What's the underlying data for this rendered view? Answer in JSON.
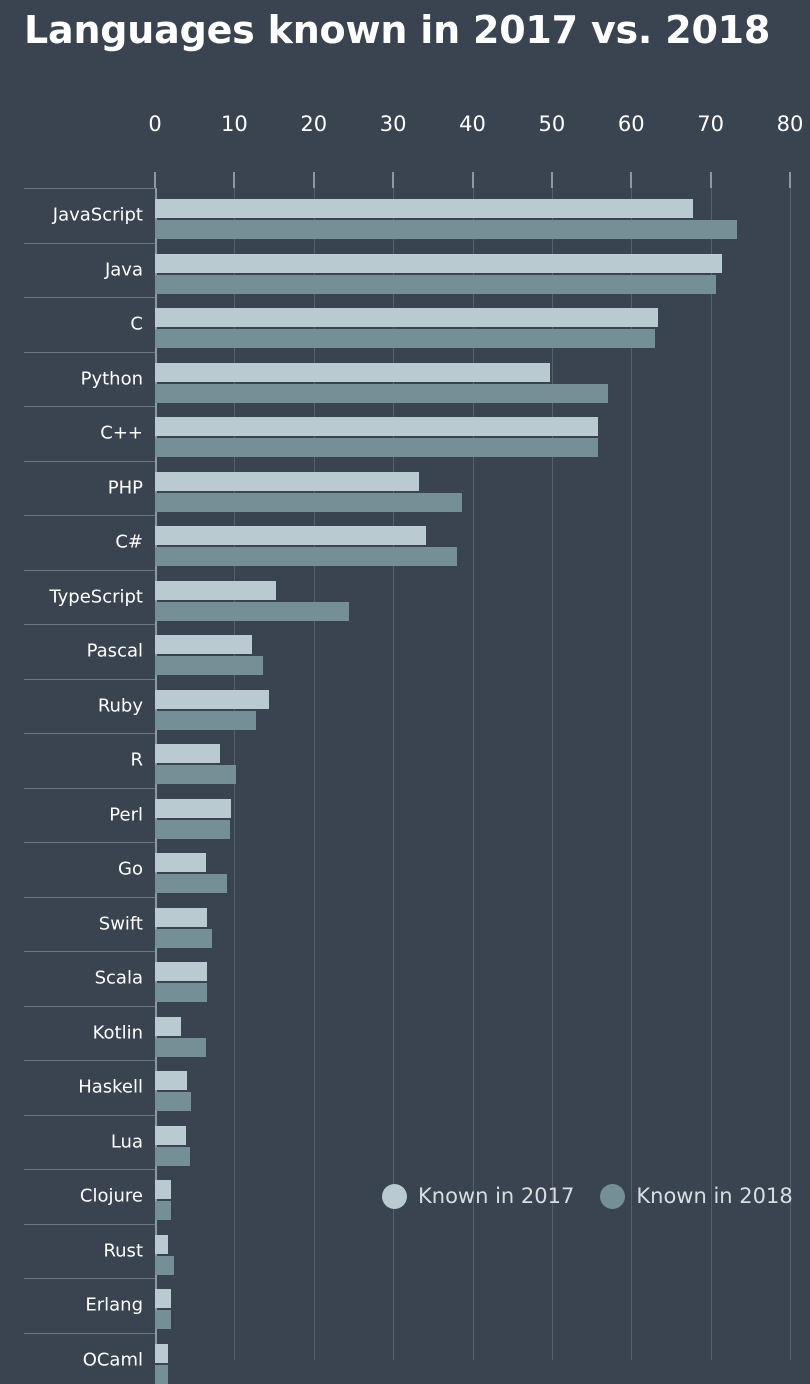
{
  "chart_data": {
    "type": "bar",
    "orientation": "horizontal",
    "title": "Languages known in 2017 vs. 2018",
    "xlabel": "",
    "ylabel": "",
    "xlim": [
      0,
      80
    ],
    "xticks": [
      0,
      10,
      20,
      30,
      40,
      50,
      60,
      70,
      80
    ],
    "grid": true,
    "legend_position": "bottom-right",
    "background_color": "#3a4450",
    "categories": [
      "JavaScript",
      "Java",
      "C",
      "Python",
      "C++",
      "PHP",
      "C#",
      "TypeScript",
      "Pascal",
      "Ruby",
      "R",
      "Perl",
      "Go",
      "Swift",
      "Scala",
      "Kotlin",
      "Haskell",
      "Lua",
      "Clojure",
      "Rust",
      "Erlang",
      "OCaml"
    ],
    "series": [
      {
        "name": "Known in 2017",
        "color": "#b9cad1",
        "values": [
          67.8,
          71.4,
          63.4,
          49.8,
          55.8,
          33.2,
          34.2,
          15.3,
          12.2,
          14.3,
          8.2,
          9.6,
          6.4,
          6.5,
          6.5,
          3.3,
          4.0,
          3.9,
          2.0,
          1.6,
          2.0,
          1.6
        ]
      },
      {
        "name": "Known in 2018",
        "color": "#758f96",
        "values": [
          73.3,
          70.7,
          63.0,
          57.1,
          55.8,
          38.7,
          38.0,
          24.4,
          13.6,
          12.7,
          10.2,
          9.5,
          9.1,
          7.2,
          6.5,
          6.4,
          4.5,
          4.4,
          2.0,
          2.4,
          2.0,
          1.6
        ]
      }
    ]
  },
  "legend": {
    "entries": [
      {
        "label": "Known in 2017",
        "color": "#b9cad1"
      },
      {
        "label": "Known in 2018",
        "color": "#758f96"
      }
    ]
  }
}
